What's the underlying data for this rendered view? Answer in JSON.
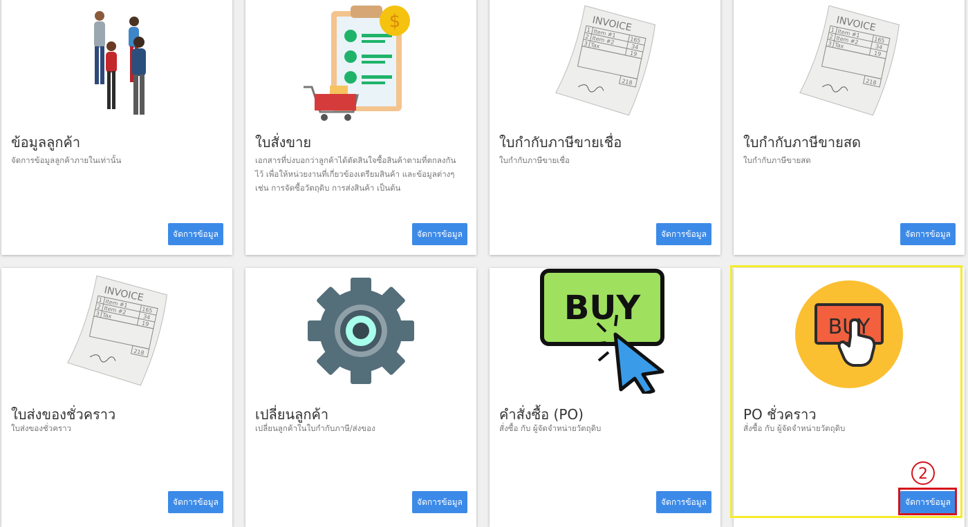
{
  "cards": [
    {
      "title": "ข้อมูลลูกค้า",
      "description": "จัดการข้อมูลลูกค้าภายในเท่านั้น",
      "button": "จัดการข้อมูล"
    },
    {
      "title": "ใบสั่งขาย",
      "description": "เอกสารที่บ่งบอกว่าลูกค้าได้ตัดสินใจซื้อสินค้าตามที่ตกลงกันไว้ เพื่อให้หน่วยงานที่เกี่ยวข้องเตรียมสินค้า และข้อมูลต่างๆ เช่น การจัดซื้อวัตถุดิบ การส่งสินค้า เป็นต้น",
      "button": "จัดการข้อมูล"
    },
    {
      "title": "ใบกำกับภาษีขายเชื่อ",
      "description": "ใบกำกับภาษีขายเชื่อ",
      "button": "จัดการข้อมูล"
    },
    {
      "title": "ใบกำกับภาษีขายสด",
      "description": "ใบกำกับภาษีขายสด",
      "button": "จัดการข้อมูล"
    },
    {
      "title": "ใบส่งของชั่วคราว",
      "description": "ใบส่งของชั่วคราว",
      "button": "จัดการข้อมูล"
    },
    {
      "title": "เปลี่ยนลูกค้า",
      "description": "เปลี่ยนลูกค้าในใบกำกับภาษี/ส่งของ",
      "button": "จัดการข้อมูล"
    },
    {
      "title": "คำสั่งซื้อ (PO)",
      "description": "สั่งซื้อ กับ ผู้จัดจำหน่ายวัตถุดิบ",
      "button": "จัดการข้อมูล"
    },
    {
      "title": "PO ชั่วคราว",
      "description": "สั่งซื้อ กับ ผู้จัดจำหน่ายวัตถุดิบ",
      "button": "จัดการข้อมูล"
    }
  ],
  "invoice": {
    "heading": "INVOICE",
    "row1": "Item #1",
    "row2": "Item #2",
    "row3": "Tax",
    "v1": "165",
    "v2": "34",
    "v3": "19",
    "total": "218",
    "n1": "1",
    "n2": "2",
    "n3": "3"
  },
  "buy_text": "BUY",
  "step_badge": "2",
  "colors": {
    "button": "#3c8ae8",
    "highlight": "#f4ec2a",
    "step": "#d5121b"
  }
}
